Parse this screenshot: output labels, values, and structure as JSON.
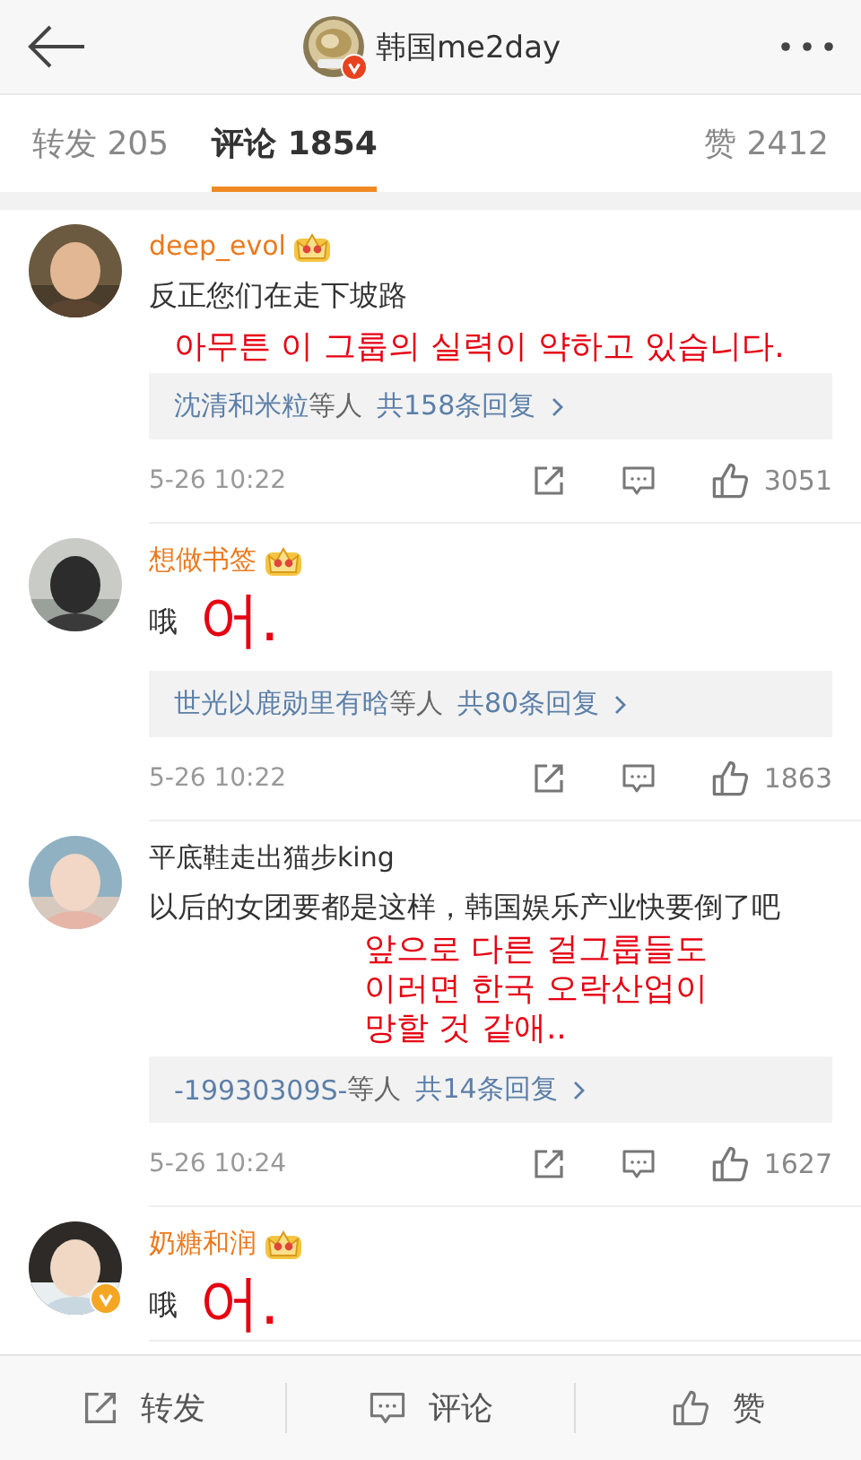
{
  "header": {
    "title": "韩国me2day",
    "verified": true
  },
  "tabs": [
    {
      "label": "转发 205",
      "selected": false
    },
    {
      "label": "评论 1854",
      "selected": true
    },
    {
      "label": "赞 2412",
      "selected": false
    }
  ],
  "comments": [
    {
      "name": "deep_evol",
      "vip": true,
      "verified": false,
      "text": "反正您们在走下坡路",
      "translation": {
        "kind": "block",
        "lines": [
          "아무튼 이 그룹의 실력이 약하고 있습니다."
        ]
      },
      "replies": {
        "users": "沈清和米粒",
        "suffix": "等人",
        "total": "共158条回复"
      },
      "time": "5-26 10:22",
      "likes": "3051"
    },
    {
      "name": "想做书签",
      "vip": true,
      "verified": false,
      "text": "哦",
      "translation": {
        "kind": "inline",
        "lines": [
          "어."
        ]
      },
      "replies": {
        "users": "世光以鹿勋里有晗",
        "suffix": "等人",
        "total": "共80条回复"
      },
      "time": "5-26 10:22",
      "likes": "1863"
    },
    {
      "name": "平底鞋走出猫步king",
      "vip": false,
      "verified": false,
      "text": "以后的女团要都是这样，韩国娱乐产业快要倒了吧",
      "translation": {
        "kind": "overlay",
        "lines": [
          "앞으로 다른 걸그룹들도",
          "이러면 한국 오락산업이",
          "망할 것 같애.."
        ]
      },
      "replies": {
        "users": "-19930309S-",
        "suffix": "等人",
        "total": "共14条回复"
      },
      "time": "5-26 10:24",
      "likes": "1627"
    },
    {
      "name": "奶糖和润",
      "vip": true,
      "verified": true,
      "text": "哦",
      "translation": {
        "kind": "inline",
        "lines": [
          "어."
        ]
      }
    }
  ],
  "bottom_bar": [
    {
      "kind": "repost",
      "label": "转发"
    },
    {
      "kind": "comment",
      "label": "评论"
    },
    {
      "kind": "like",
      "label": "赞"
    }
  ]
}
